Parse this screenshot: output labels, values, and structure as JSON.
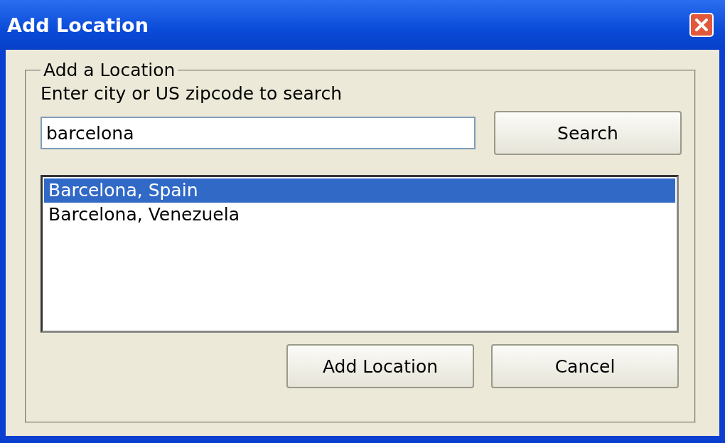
{
  "window": {
    "title": "Add Location"
  },
  "group": {
    "legend": "Add a Location",
    "prompt": "Enter city or US zipcode to search"
  },
  "search": {
    "value": "barcelona",
    "button": "Search"
  },
  "results": [
    {
      "label": "Barcelona, Spain",
      "selected": true
    },
    {
      "label": "Barcelona, Venezuela",
      "selected": false
    }
  ],
  "buttons": [
    "Add Location",
    "Cancel"
  ]
}
